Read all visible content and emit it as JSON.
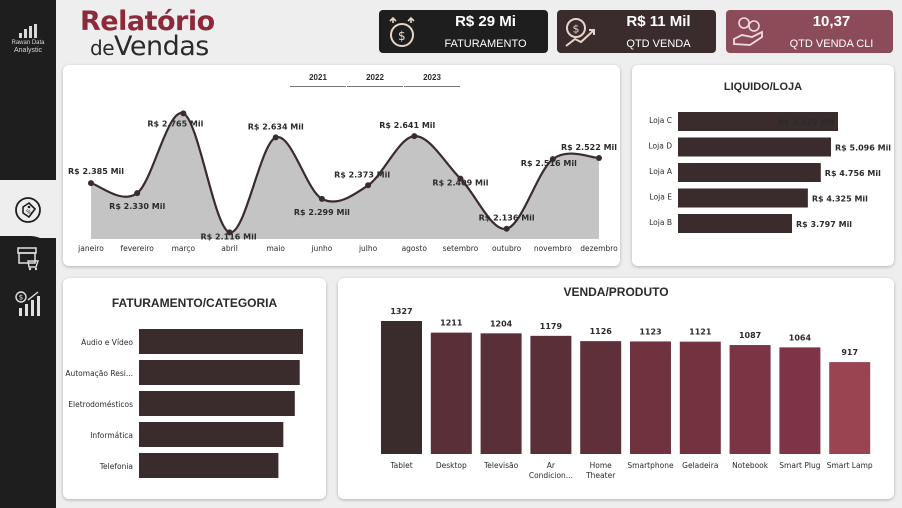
{
  "sidebar": {
    "logo_line1": "Rawan Data",
    "logo_line2": "Analystic",
    "nav": [
      "sales-tag-icon",
      "store-cart-icon",
      "money-growth-icon"
    ]
  },
  "title": {
    "line1": "Relatório",
    "line2_prefix": "de",
    "line2_word": "Vendas"
  },
  "kpis": [
    {
      "value": "R$ 29 Mi",
      "label": "FATURAMENTO",
      "color": "#1e1e1e"
    },
    {
      "value": "R$ 11 Mil",
      "label": "QTD VENDA",
      "color": "#3a2b2d"
    },
    {
      "value": "10,37",
      "label": "QTD VENDA CLI",
      "color": "#8c4b59"
    }
  ],
  "year_tabs": [
    "2021",
    "2022",
    "2023"
  ],
  "monthly_chart": {
    "chart_data": {
      "type": "area",
      "categories": [
        "janeiro",
        "fevereiro",
        "março",
        "abril",
        "maio",
        "junho",
        "julho",
        "agosto",
        "setembro",
        "outubro",
        "novembro",
        "dezembro"
      ],
      "values": [
        2385,
        2330,
        2765,
        2116,
        2634,
        2299,
        2373,
        2641,
        2409,
        2136,
        2516,
        2522
      ],
      "labels": [
        "R$ 2.385 Mil",
        "R$ 2.330 Mil",
        "R$ 2.765 Mil",
        "R$ 2.116 Mil",
        "R$ 2.634 Mil",
        "R$ 2.299 Mil",
        "R$ 2.373 Mil",
        "R$ 2.641 Mil",
        "R$ 2.409 Mil",
        "R$ 2.136 Mil",
        "R$ 2.516 Mil",
        "R$ 2.522 Mil"
      ],
      "ylim": [
        2080,
        2800
      ]
    }
  },
  "liquido_loja": {
    "title": "LIQUIDO/LOJA",
    "chart_data": {
      "type": "bar",
      "categories": [
        "Loja C",
        "Loja D",
        "Loja A",
        "Loja E",
        "Loja B"
      ],
      "values": [
        5329,
        5096,
        4756,
        4325,
        3797
      ],
      "labels": [
        "R$ 5.329 Mil",
        "R$ 5.096 Mil",
        "R$ 4.756 Mil",
        "R$ 4.325 Mil",
        "R$ 3.797 Mil"
      ]
    }
  },
  "faturamento_categoria": {
    "title": "FATURAMENTO/CATEGORIA",
    "chart_data": {
      "type": "bar",
      "categories": [
        "Áudio e Vídeo",
        "Automação Resi...",
        "Eletrodomésticos",
        "Informática",
        "Telefonia"
      ],
      "values": [
        100,
        98,
        95,
        88,
        85
      ]
    }
  },
  "venda_produto": {
    "title": "VENDA/PRODUTO",
    "chart_data": {
      "type": "bar",
      "categories": [
        "Tablet",
        "Desktop",
        "Televisão",
        "Ar Condicion...",
        "Home Theater",
        "Smartphone",
        "Geladeira",
        "Notebook",
        "Smart Plug",
        "Smart Lamp"
      ],
      "values": [
        1327,
        1211,
        1204,
        1179,
        1126,
        1123,
        1121,
        1087,
        1064,
        917
      ],
      "colors": [
        "#3a2b2d",
        "#5a2f38",
        "#5a2f38",
        "#5a2f38",
        "#5f3039",
        "#70323f",
        "#72323f",
        "#7a3444",
        "#7e3446",
        "#9a4452"
      ]
    }
  }
}
